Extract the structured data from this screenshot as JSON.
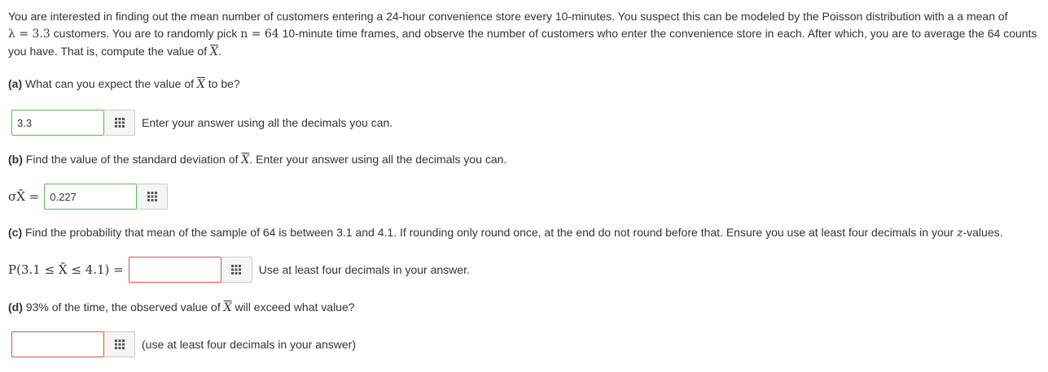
{
  "intro": {
    "line1": "You are interested in finding out the mean number of customers entering a 24-hour convenience store every 10-minutes. You suspect this can be modeled by the Poisson distribution with a a mean of",
    "line2_pre": "λ = 3.3",
    "line2_mid": " customers. You are to randomly pick ",
    "line2_n": "n = 64",
    "line2_post": " 10-minute time frames, and observe the number of customers who enter the convenience store in each. After which, you are to average the 64 counts",
    "line3_pre": "you have. That is, compute the value of ",
    "line3_x": "X",
    "line3_post": "."
  },
  "a": {
    "label": "(a)",
    "text_pre": " What can you expect the value of ",
    "x": "X",
    "text_post": " to be?",
    "value": "3.3",
    "hint": "Enter your answer using all the decimals you can."
  },
  "b": {
    "label": "(b)",
    "text_pre": " Find the value of the standard deviation of ",
    "x": "X",
    "text_post": ". Enter your answer using all the decimals you can.",
    "sigma_label": "σX̄ =",
    "value": "0.227"
  },
  "c": {
    "label": "(c)",
    "text_pre": " Find the probability that mean of the sample of 64 is between 3.1 and 4.1. If rounding only round once, at the end do not round before that. Ensure you use at least four decimals in your ",
    "z": "z",
    "text_post": "-values.",
    "prob_label": "P(3.1 ≤ X̄ ≤ 4.1) =",
    "value": "",
    "hint": "Use at least four decimals in your answer."
  },
  "d": {
    "label": "(d)",
    "text_pre": " 93% of the time, the observed value of ",
    "x": "X",
    "text_post": " will exceed what value?",
    "value": "",
    "hint": "(use at least four decimals in your answer)"
  },
  "colors": {
    "valid_border": "#5cb85c",
    "invalid_border": "#d9534f"
  },
  "icons": {
    "keypad": "keypad-icon"
  }
}
